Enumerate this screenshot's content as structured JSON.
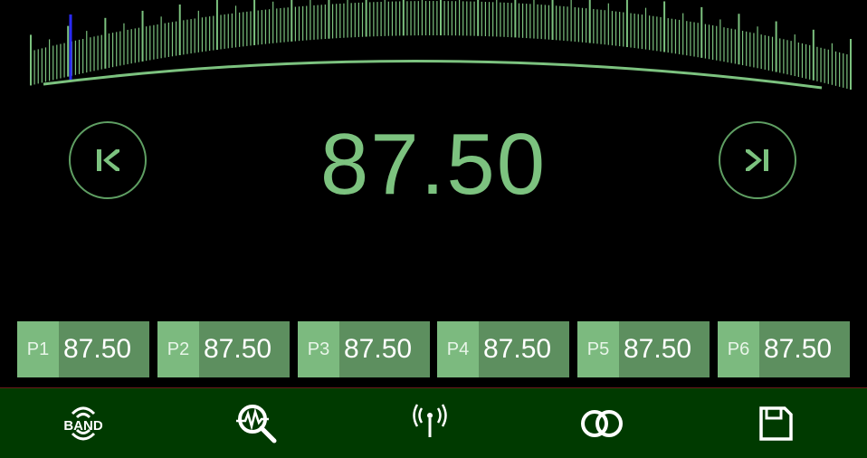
{
  "tuner": {
    "frequency": "87.50",
    "seek_back_icon": "seek-back-icon",
    "seek_forward_icon": "seek-forward-icon"
  },
  "dial": {
    "pointer_color": "#2a2aff",
    "scale_color": "#7cc27f"
  },
  "presets": [
    {
      "label": "P1",
      "value": "87.50"
    },
    {
      "label": "P2",
      "value": "87.50"
    },
    {
      "label": "P3",
      "value": "87.50"
    },
    {
      "label": "P4",
      "value": "87.50"
    },
    {
      "label": "P5",
      "value": "87.50"
    },
    {
      "label": "P6",
      "value": "87.50"
    }
  ],
  "toolbar": {
    "band_label": "BAND",
    "items": [
      "band-icon",
      "scan-icon",
      "antenna-icon",
      "stereo-icon",
      "save-icon"
    ]
  },
  "colors": {
    "accent": "#7cc27f",
    "preset_bg": "#5d8f5f",
    "preset_label_bg": "#7cba7f",
    "toolbar_bg": "#003a00"
  }
}
